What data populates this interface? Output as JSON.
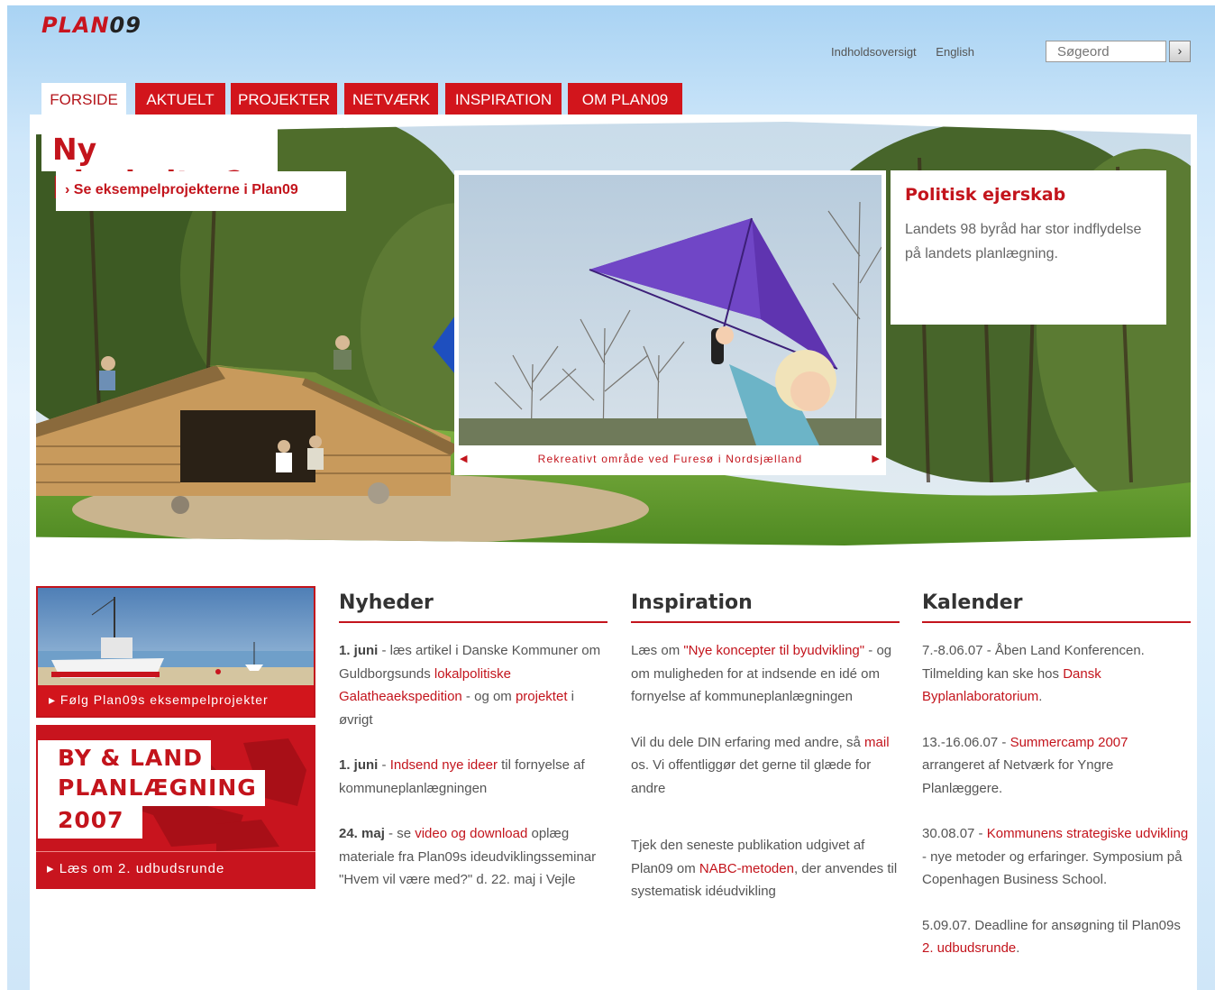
{
  "logo": {
    "text_a": "PLAN",
    "text_b": "09"
  },
  "header": {
    "links": [
      "Indholdsoversigt",
      "English"
    ],
    "search_placeholder": "Søgeord",
    "search_button": "›"
  },
  "nav": {
    "tabs": [
      "FORSIDE",
      "AKTUELT",
      "PROJEKTER",
      "NETVÆRK",
      "INSPIRATION",
      "OM PLAN09"
    ],
    "active": "FORSIDE"
  },
  "hero": {
    "title": "Ny plankultur?",
    "link": "› Se eksempelprojekterne i Plan09",
    "caption": "Rekreativt område ved Furesø i Nordsjælland",
    "info_title": "Politisk ejerskab",
    "info_text": "Landets 98 byråd har stor indflydelse på landets planlægning."
  },
  "promos": {
    "promo1_link": "Følg Plan09s eksempelprojekter",
    "promo2_title_1": "BY & LAND",
    "promo2_title_2": "PLANLÆGNING",
    "promo2_title_3": "2007",
    "promo2_link": "Læs om 2. udbudsrunde"
  },
  "columns": {
    "nyheder": {
      "heading": "Nyheder",
      "items": [
        {
          "date": "1. juni",
          "t1": " - læs artikel i Danske Kommuner om Guldborgsunds ",
          "l1": "lokalpolitiske Galatheaekspedition",
          "t2": " - og om ",
          "l2": "projektet",
          "t3": " i øvrigt"
        },
        {
          "date": "1. juni",
          "t1": " - ",
          "l1": "Indsend nye ideer",
          "t2": " til fornyelse af kommuneplanlægningen"
        },
        {
          "date": "24. maj",
          "t1": " - se ",
          "l1": "video og download",
          "t2": " oplæg materiale fra Plan09s ideudviklingsseminar \"Hvem vil være med?\" d. 22. maj i Vejle"
        }
      ]
    },
    "inspiration": {
      "heading": "Inspiration",
      "items": [
        {
          "t1": "Læs om ",
          "l1": "\"Nye koncepter til byudvikling\"",
          "t2": " - og om muligheden for at indsende en idé om fornyelse af kommuneplanlægningen"
        },
        {
          "t1": "Vil du dele DIN erfaring med andre, så ",
          "l1": "mail",
          "t2": " os. Vi offentliggør det gerne til glæde for andre"
        },
        {
          "t1": "Tjek den seneste publikation udgivet af Plan09 om ",
          "l1": "NABC-metoden",
          "t2": ", der anvendes til systematisk idéudvikling"
        }
      ]
    },
    "kalender": {
      "heading": "Kalender",
      "items": [
        {
          "t1": "7.-8.06.07 - Åben Land Konferencen. Tilmelding kan ske hos ",
          "l1": "Dansk Byplanlaboratorium",
          "t2": "."
        },
        {
          "t1": "13.-16.06.07 - ",
          "l1": "Summercamp 2007",
          "t2": " arrangeret af Netværk for Yngre Planlæggere."
        },
        {
          "t1": "30.08.07 - ",
          "l1": "Kommunens strategiske udvikling",
          "t2": " - nye metoder og erfaringer. Symposium på Copenhagen Business School."
        },
        {
          "t1": "5.09.07. Deadline for ansøgning til Plan09s ",
          "l1": "2. udbudsrunde",
          "t2": "."
        }
      ]
    }
  },
  "colors": {
    "brand_red": "#d2151c",
    "link_red": "#c3141c"
  }
}
